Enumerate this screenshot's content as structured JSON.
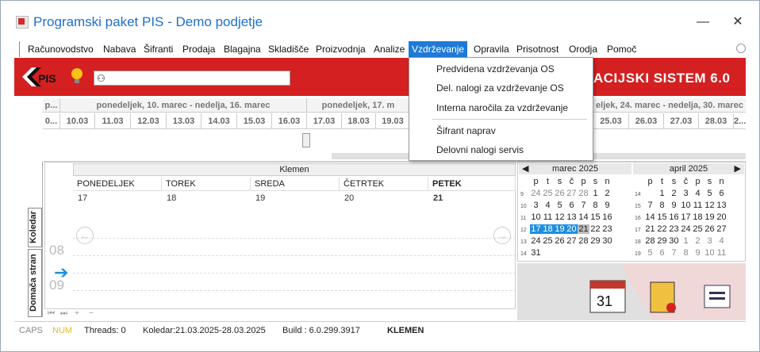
{
  "window": {
    "title": "Programski paket PIS - Demo podjetje",
    "minimize": "—",
    "close": "✕"
  },
  "menu": [
    "Računovodstvo",
    "Nabava",
    "Šifranti",
    "Prodaja",
    "Blagajna",
    "Skladišče",
    "Proizvodnja",
    "Analize",
    "Vzdrževanje",
    "Opravila",
    "Prisotnost",
    "Orodja",
    "Pomoč"
  ],
  "toolbar": {
    "logo": "PIS",
    "search_value": "",
    "system_label": "ACIJSKI SISTEM 6.0"
  },
  "dropdown": {
    "items": [
      "Predvidena vzdrževanja OS",
      "Del. nalogi za vzdrževanje OS",
      "Interna naročila za vzdrževanje",
      "Šifrant naprav",
      "Delovni nalogi servis"
    ]
  },
  "timeline": {
    "weeks": [
      "p...",
      "ponedeljek, 10. marec - nedelja, 16. marec",
      "ponedeljek, 17. m",
      "eljek, 24. marec - nedelja, 30. marec"
    ],
    "days": [
      "0...",
      "10.03",
      "11.03",
      "12.03",
      "13.03",
      "14.03",
      "15.03",
      "16.03",
      "17.03",
      "18.03",
      "19.03",
      "25.03",
      "26.03",
      "27.03",
      "28.03",
      "2..."
    ]
  },
  "sidetabs": {
    "koledar": "Koledar",
    "domaca": "Domača stran"
  },
  "calendar": {
    "resource": "Klemen",
    "columns": [
      "PONEDELJEK",
      "TOREK",
      "SREDA",
      "ČETRTEK",
      "PETEK"
    ],
    "dates": [
      "17",
      "18",
      "19",
      "20",
      "21"
    ],
    "hours": [
      "08",
      "09"
    ],
    "nav_prev": "←",
    "nav_next": "→",
    "now_marker": "➔",
    "footer": [
      "⏮",
      "⏭",
      "+",
      "−"
    ]
  },
  "minical": {
    "prev": "◀",
    "next": "▶",
    "months": [
      {
        "title": "marec 2025",
        "weekdays": [
          "p",
          "t",
          "s",
          "č",
          "p",
          "s",
          "n"
        ],
        "weeks": [
          "9",
          "10",
          "11",
          "12",
          "13",
          "14"
        ],
        "rows": [
          [
            "24",
            "25",
            "26",
            "27",
            "28",
            "1",
            "2"
          ],
          [
            "3",
            "4",
            "5",
            "6",
            "7",
            "8",
            "9"
          ],
          [
            "10",
            "11",
            "12",
            "13",
            "14",
            "15",
            "16"
          ],
          [
            "17",
            "18",
            "19",
            "20",
            "21",
            "22",
            "23"
          ],
          [
            "24",
            "25",
            "26",
            "27",
            "28",
            "29",
            "30"
          ],
          [
            "31",
            "",
            "",
            "",
            "",
            "",
            ""
          ]
        ]
      },
      {
        "title": "april 2025",
        "weekdays": [
          "p",
          "t",
          "s",
          "č",
          "p",
          "s",
          "n"
        ],
        "weeks": [
          "14",
          "15",
          "16",
          "17",
          "18",
          "19"
        ],
        "rows": [
          [
            "",
            "1",
            "2",
            "3",
            "4",
            "5",
            "6"
          ],
          [
            "7",
            "8",
            "9",
            "10",
            "11",
            "12",
            "13"
          ],
          [
            "14",
            "15",
            "16",
            "17",
            "18",
            "19",
            "20"
          ],
          [
            "21",
            "22",
            "23",
            "24",
            "25",
            "26",
            "27"
          ],
          [
            "28",
            "29",
            "30",
            "1",
            "2",
            "3",
            "4"
          ],
          [
            "5",
            "6",
            "7",
            "8",
            "9",
            "10",
            "11"
          ]
        ]
      }
    ]
  },
  "tiles": {
    "calendar_day": "31"
  },
  "status": {
    "caps": "CAPS",
    "num": "NUM",
    "threads": "Threads: 0",
    "koledar": "Koledar:21.03.2025-28.03.2025",
    "build": "Build : 6.0.299.3917",
    "user": "KLEMEN"
  },
  "colors": {
    "accent": "#1e7ad8",
    "brand_red": "#d42020"
  }
}
